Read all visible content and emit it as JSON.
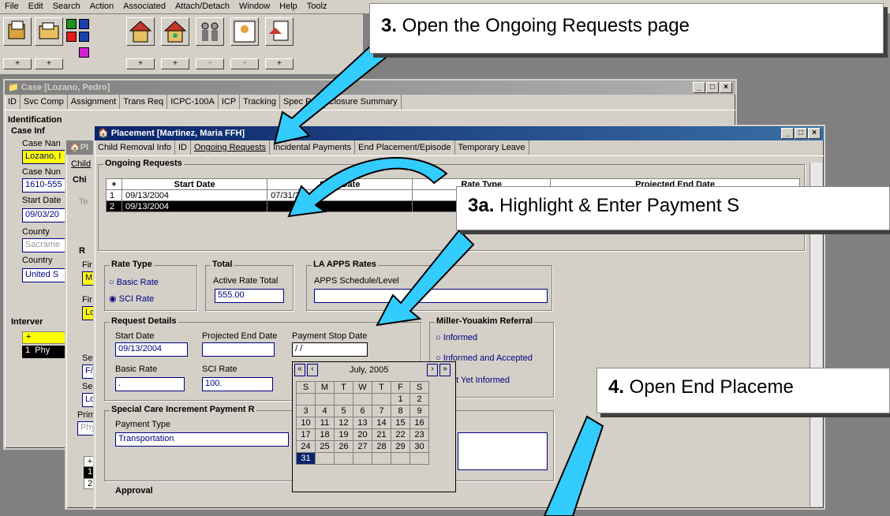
{
  "menu": [
    "File",
    "Edit",
    "Search",
    "Action",
    "Associated",
    "Attach/Detach",
    "Window",
    "Help",
    "Toolz"
  ],
  "toolbar": {
    "plus_label": "+"
  },
  "case_window": {
    "title": "Case [Lozano, Pedro]",
    "tabs": [
      "ID",
      "Svc Comp",
      "Assignment",
      "Trans Req",
      "ICPC-100A",
      "ICP",
      "Tracking",
      "Spec Proj",
      "Closure Summary"
    ],
    "group_identification": "Identification",
    "group_case_info": "Case Inf",
    "case_name_label": "Case Nan",
    "case_name_value": "Lozano, I",
    "case_num_label": "Case Nun",
    "case_num_value": "1610-555",
    "start_date_label": "Start Date",
    "start_date_value": "09/03/20",
    "county_label": "County",
    "county_value": "Sacrame",
    "country_label": "Country",
    "country_value": "United S",
    "interventions_label": "Interver",
    "intervention_row": "Phy",
    "intervention_row_num": "1"
  },
  "placement_back": {
    "title": "Pl",
    "tab_child": "Child",
    "group_chi": "Chi",
    "te_label": "Te",
    "r_label": "R",
    "fir1": "Fir",
    "fir1_val": "M",
    "fir2": "Fir",
    "fir2_val": "Lo",
    "se1": "Se",
    "se1_val": "F/",
    "se2": "Se",
    "se2_val": "Lo",
    "prim": "Prim",
    "prim_val": "Phy",
    "row1": "1",
    "row2": "2"
  },
  "placement_front": {
    "title": "Placement [Martinez, Maria FFH]",
    "tabs": [
      "Child Removal Info",
      "ID",
      "Ongoing Requests",
      "Incidental Payments",
      "End Placement/Episode",
      "Temporary Leave"
    ],
    "group_ongoing": "Ongoing Requests",
    "table_headers": [
      "+",
      "Start Date",
      "Stop Date",
      "Rate Type",
      "Projected End Date"
    ],
    "rows": [
      {
        "num": "1",
        "start": "09/13/2004",
        "stop": "07/31/2005"
      },
      {
        "num": "2",
        "start": "09/13/2004",
        "stop": ""
      }
    ],
    "rate_type_label": "Rate Type",
    "basic_rate": "Basic Rate",
    "sci_rate": "SCI Rate",
    "total_label": "Total",
    "active_rate_total": "Active Rate Total",
    "total_value": "555.00",
    "la_apps_label": "LA APPS Rates",
    "apps_schedule": "APPS Schedule/Level",
    "request_details": "Request Details",
    "start_date_label": "Start Date",
    "start_date_value": "09/13/2004",
    "proj_end_label": "Projected End Date",
    "pay_stop_label": "Payment Stop Date",
    "pay_stop_value": "/ /",
    "basic_rate_label": "Basic Rate",
    "basic_rate_value": ".",
    "sci_rate_label": "SCI Rate",
    "sci_rate_value": "100.",
    "miller_label": "Miller-Youakim Referral",
    "informed": "Informed",
    "informed_accepted": "Informed and Accepted",
    "not_yet": "ot Yet Informed",
    "special_care": "Special Care Increment Payment R",
    "payment_type_label": "Payment Type",
    "payment_type_value": "Transportation",
    "approval": "Approval"
  },
  "calendar": {
    "month": "July, 2005",
    "days": [
      "S",
      "M",
      "T",
      "W",
      "T",
      "F",
      "S"
    ],
    "weeks": [
      [
        "",
        "",
        "",
        "",
        "",
        "1",
        "2"
      ],
      [
        "3",
        "4",
        "5",
        "6",
        "7",
        "8",
        "9"
      ],
      [
        "10",
        "11",
        "12",
        "13",
        "14",
        "15",
        "16"
      ],
      [
        "17",
        "18",
        "19",
        "20",
        "21",
        "22",
        "23"
      ],
      [
        "24",
        "25",
        "26",
        "27",
        "28",
        "29",
        "30"
      ],
      [
        "31",
        "",
        "",
        "",
        "",
        "",
        ""
      ]
    ],
    "selected": "31"
  },
  "callouts": {
    "c3_num": "3.",
    "c3_text": " Open the Ongoing Requests page",
    "c3a_num": "3a.",
    "c3a_text": " Highlight & Enter Payment S",
    "c4_num": "4.",
    "c4_text": " Open End Placeme"
  },
  "colors": {
    "arrow": "#33ccff",
    "title_active": "#0a246a",
    "highlight": "#000000"
  }
}
